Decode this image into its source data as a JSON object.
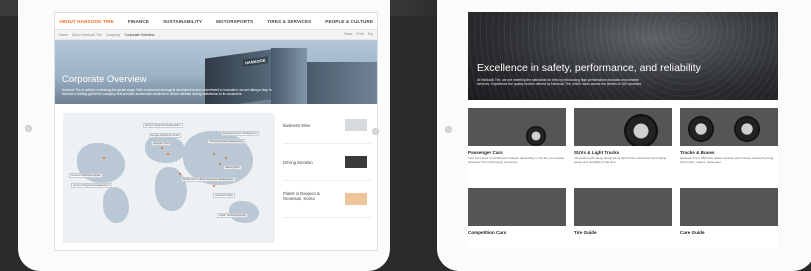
{
  "left_screen": {
    "nav": [
      "ABOUT HANKOOK TIRE",
      "FINANCE",
      "SUSTAINABILITY",
      "MOTORSPORTS",
      "TIRES & SERVICES",
      "PEOPLE & CULTURE"
    ],
    "breadcrumb": [
      "Home",
      "About Hankook Tire",
      "Company",
      "Corporate Overview"
    ],
    "tools": [
      "Share",
      "Print",
      "Top"
    ],
    "hero": {
      "title": "Corporate Overview",
      "text": "Hankook Tire is actively embracing the global stage. With constant technological development and commitment to innovation, we are taking a leap to become a leading global tire company that provides sustainable solutions to deliver ultimate driving satisfaction to its customers.",
      "sign": "HANKOOK"
    },
    "map_labels": [
      "Europe Regional Headquarters",
      "Europe Technical Center",
      "Hungary Plant",
      "China Regional Headquarters",
      "Korea Regional Headquarters",
      "Jiaxing Plant",
      "Middle East & Africa Regional Headquarters",
      "America Technical Center",
      "America Regional Headquarters",
      "Indonesia Plant",
      "Japan Technical Center"
    ],
    "sidebar": [
      {
        "label": "Business Wise"
      },
      {
        "label": "Driving Emotion"
      },
      {
        "label": "Plants in Daejeon & Geumsan, Korea"
      }
    ]
  },
  "right_screen": {
    "hero": {
      "title": "Excellence in safety, performance, and reliability",
      "text": "At Hankook Tire, we are rewriting the standards for tires by introducing high-performance products and creative services. Experience the quality service offered by Hankook Tire, which races across the streets of 180 countries."
    },
    "tiles": [
      {
        "title": "Passenger Cars",
        "desc": "Your car's level of confidence changes depending on the tire you choose. Hankook Tire's technology and know-",
        "img": "i-car"
      },
      {
        "title": "SUVs & Light Trucks",
        "desc": "Innovative technology designed for light trucks maximizes the braking power and durability of the tires",
        "img": "i-suv"
      },
      {
        "title": "Trucks & Buses",
        "desc": "Hankook Tire's TBR tires deliver optimal performance required by long-haul trucks, trailers, passenger",
        "img": "i-truck"
      },
      {
        "title": "Competition Cars",
        "desc": "",
        "img": "i-race"
      },
      {
        "title": "Tire Guide",
        "desc": "",
        "img": "i-guide"
      },
      {
        "title": "Care Guide",
        "desc": "",
        "img": "i-care"
      }
    ]
  }
}
